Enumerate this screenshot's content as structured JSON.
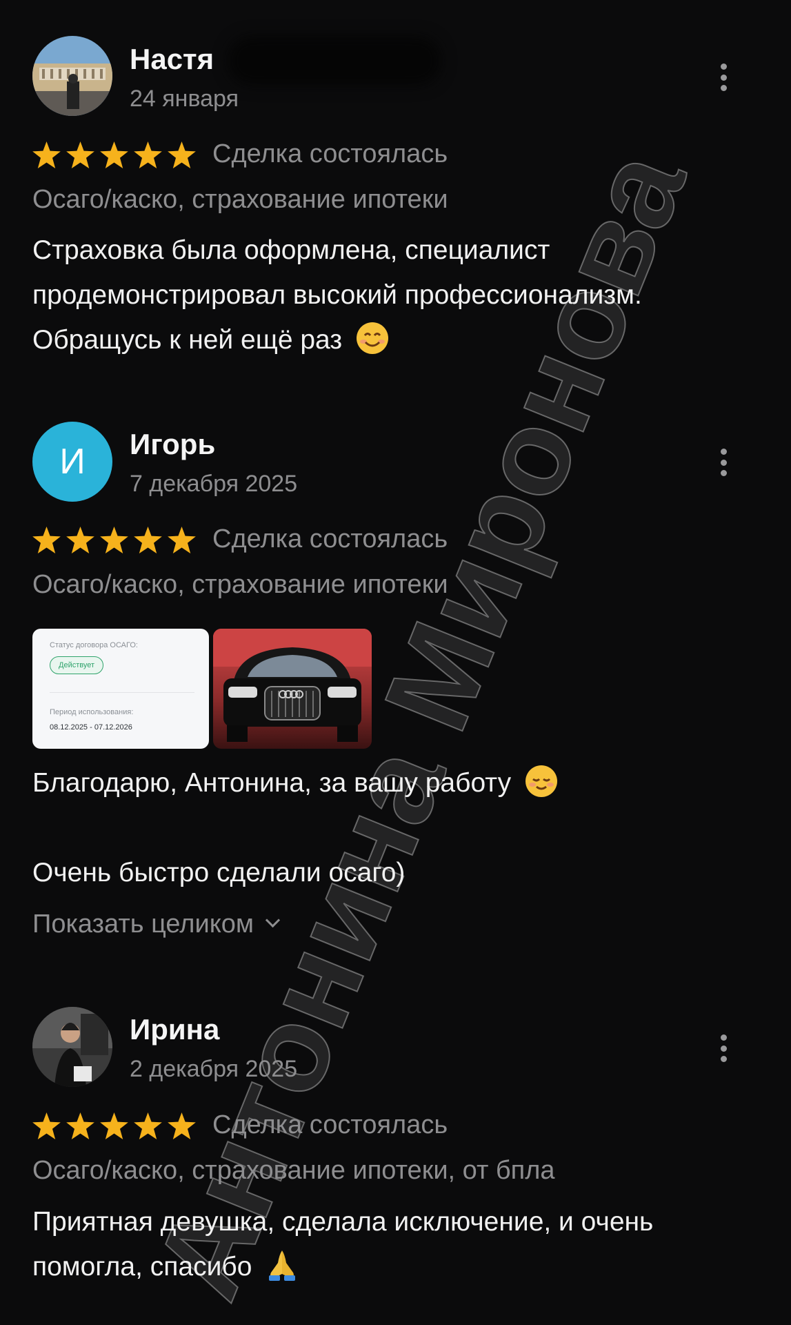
{
  "watermark": "Антонина Миронова",
  "reviews": [
    {
      "name": "Настя",
      "date": "24 января",
      "rating": 5,
      "status": "Сделка состоялась",
      "category": "Осаго/каско, страхование ипотеки",
      "text": "Страховка была оформлена, специалист продемонстрировал высокий профессионализм. Обращусь к ней ещё раз",
      "avatar_icon": "photo-avatar-stadium"
    },
    {
      "name": "Игорь",
      "avatar_letter": "И",
      "date": "7 декабря 2025",
      "rating": 5,
      "status": "Сделка состоялась",
      "category": "Осаго/каско, страхование ипотеки",
      "doc": {
        "status_label": "Статус договора ОСАГО:",
        "badge": "Действует",
        "period_label": "Период использования:",
        "period": "08.12.2025 - 07.12.2026"
      },
      "text_line1": "Благодарю, Антонина, за вашу работу",
      "text_line2": "Очень быстро сделали осаго)",
      "show_more": "Показать целиком"
    },
    {
      "name": "Ирина",
      "date": "2 декабря 2025",
      "rating": 5,
      "status": "Сделка состоялась",
      "category": "Осаго/каско, страхование ипотеки, от бпла",
      "text": "Приятная девушка, сделала исключение, и очень помогла, спасибо",
      "avatar_icon": "photo-avatar-person"
    }
  ],
  "colors": {
    "background": "#0b0b0c",
    "star": "#f6b21c",
    "muted_text": "#8e8e90",
    "avatar_letter_bg": "#2ab3d9",
    "badge_green": "#2fa36b"
  }
}
